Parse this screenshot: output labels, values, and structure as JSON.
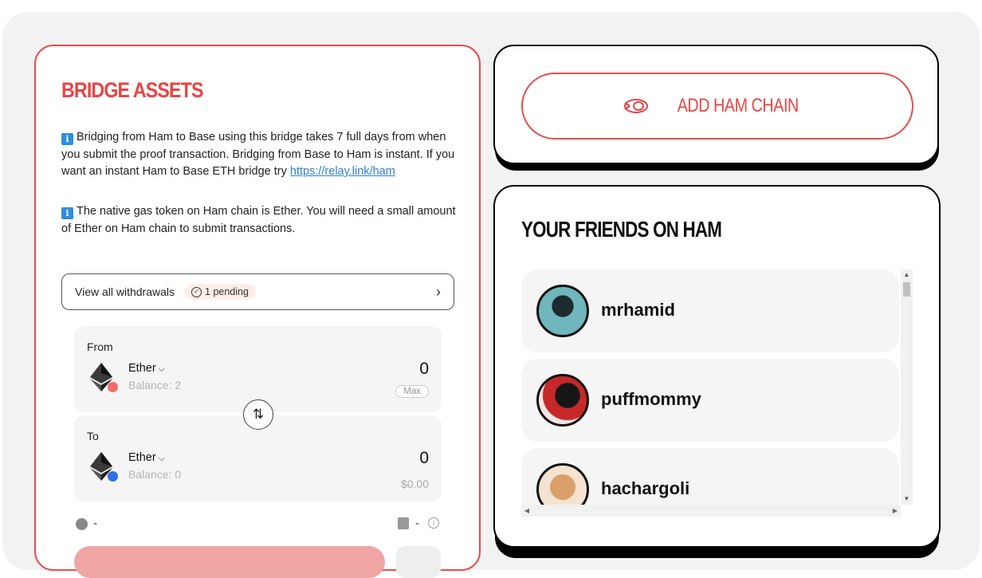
{
  "bridge": {
    "title": "BRIDGE ASSETS",
    "info1_text": "Bridging from Ham to Base using this bridge takes 7 full days from when you submit the proof transaction. Bridging from Base to Ham is instant. If you want an instant Ham to Base ETH bridge try ",
    "info1_link": "https://relay.link/ham",
    "info2_text": "The native gas token on Ham chain is Ether. You will need a small amount of Ether on Ham chain to submit transactions.",
    "withdrawals_label": "View all withdrawals",
    "pending_label": "1 pending",
    "from": {
      "label": "From",
      "token": "Ether",
      "balance": "Balance: 2",
      "amount": "0",
      "max_label": "Max"
    },
    "to": {
      "label": "To",
      "token": "Ether",
      "balance": "Balance: 0",
      "amount": "0",
      "usd": "$0.00"
    },
    "eta": "-",
    "gas": "-"
  },
  "add_chain": {
    "label": "ADD HAM CHAIN"
  },
  "friends": {
    "title": "YOUR FRIENDS ON HAM",
    "items": [
      {
        "name": "mrhamid"
      },
      {
        "name": "puffmommy"
      },
      {
        "name": "hachargoli"
      }
    ]
  },
  "colors": {
    "accent": "#e84d4d",
    "link": "#2f7fd3"
  },
  "icons": [
    "info-icon",
    "check-circle-icon",
    "chevron-right-icon",
    "ethereum-icon",
    "swap-icon",
    "clock-icon",
    "gas-pump-icon",
    "ham-logo-icon"
  ]
}
